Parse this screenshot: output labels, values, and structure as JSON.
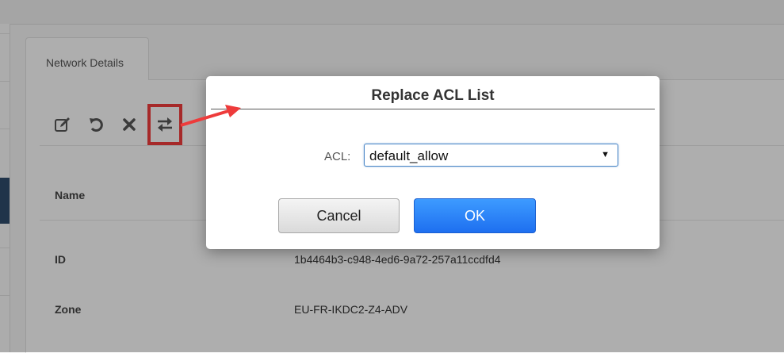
{
  "tab": {
    "label": "Network Details"
  },
  "toolbar": {
    "icons": [
      "edit-icon",
      "refresh-icon",
      "delete-icon",
      "replace-acl-icon"
    ]
  },
  "details": {
    "name_label": "Name",
    "id_label": "ID",
    "id_value": "1b4464b3-c948-4ed6-9a72-257a11ccdfd4",
    "zone_label": "Zone",
    "zone_value": "EU-FR-IKDC2-Z4-ADV"
  },
  "modal": {
    "title": "Replace ACL List",
    "acl_label": "ACL:",
    "acl_selected": "default_allow",
    "cancel_label": "Cancel",
    "ok_label": "OK"
  },
  "colors": {
    "annotation": "#ee3b3b",
    "ok_button": "#1e6ff0",
    "nav_active": "#2f4b6a"
  }
}
